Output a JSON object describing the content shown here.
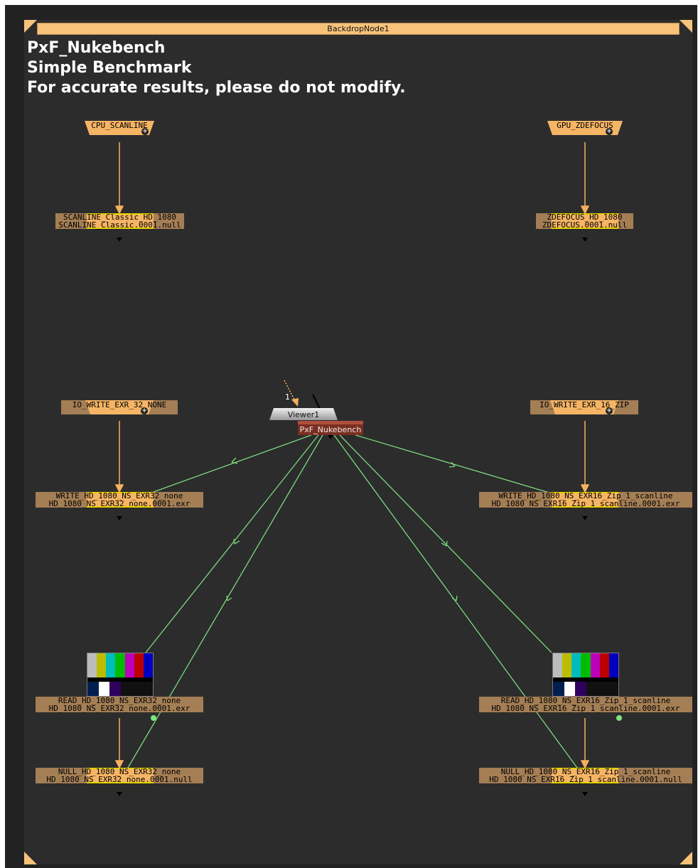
{
  "backdrop": {
    "label": "BackdropNode1",
    "title_lines": [
      "PxF_Nukebench",
      "Simple Benchmark",
      "For accurate results, please do not modify."
    ]
  },
  "groups": {
    "cpu_scanline": "CPU_SCANLINE",
    "gpu_zdefocus": "GPU_ZDEFOCUS",
    "io_write_exr_32": "IO_WRITE_EXR_32_NONE",
    "io_write_exr_16": "IO_WRITE_EXR_16_ZIP"
  },
  "nodes": {
    "scanline": {
      "name": "SCANLINE_Classic_HD_1080",
      "file": "SCANLINE_Classic.0001.null"
    },
    "zdefocus": {
      "name": "ZDEFOCUS_HD_1080",
      "file": "ZDEFOCUS.0001.null"
    },
    "write32": {
      "name": "WRITE_HD_1080_NS_EXR32_none",
      "file": "HD_1080_NS_EXR32_none.0001.exr"
    },
    "write16": {
      "name": "WRITE_HD_1080_NS_EXR16_Zip_1_scanline",
      "file": "HD_1080_NS_EXR16_Zip_1_scanline.0001.exr"
    },
    "read32": {
      "name": "READ_HD_1080_NS_EXR32_none",
      "file": "HD_1080_NS_EXR32_none.0001.exr"
    },
    "read16": {
      "name": "READ_HD_1080_NS_EXR16_Zip_1_scanline",
      "file": "HD_1080_NS_EXR16_Zip_1_scanline.0001.exr"
    },
    "null32": {
      "name": "NULL_HD_1080_NS_EXR32_none",
      "file": "HD_1080_NS_EXR32_none.0001.null"
    },
    "null16": {
      "name": "NULL_HD_1080_NS_EXR16_Zip_1_scanline",
      "file": "HD_1080_NS_EXR16_Zip_1_scanline.0001.null"
    }
  },
  "viewer": {
    "label": "Viewer1",
    "input_label": "1"
  },
  "main_node": {
    "label": "PxF_Nukebench"
  },
  "colors": {
    "backdrop": "#f7c37a",
    "group_node": "#f6b465",
    "node": "#a47e55",
    "pipe_orange": "#f5b060",
    "pipe_green": "#7ed87e",
    "main_node": "#7a2e22"
  }
}
